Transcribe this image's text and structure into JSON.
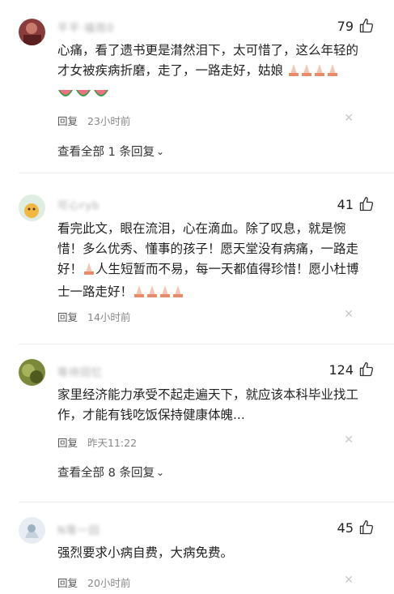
{
  "comments": [
    {
      "username": "平平·福雨0",
      "likes": "79",
      "text": "心痛，看了遗书更是潸然泪下，太可惜了，这么年轻的才女被疾病折磨，走了，一路走好，姑娘",
      "reply_label": "回复",
      "time": "23小时前",
      "more_replies": "查看全部 1 条回复"
    },
    {
      "username": "可心ryb",
      "likes": "41",
      "text_a": "看完此文，眼在流泪，心在滴血。除了叹息，就是惋惜！多么优秀、懂事的孩子！愿天堂没有病痛，一路走好！",
      "text_b": "人生短暂而不易，每一天都值得珍惜！愿小杜博士一路走好！",
      "reply_label": "回复",
      "time": "14小时前"
    },
    {
      "username": "等待回忆",
      "likes": "124",
      "text": "家里经济能力承受不起走遍天下，就应该本科毕业找工作，才能有钱吃饭保持健康体魄...",
      "reply_label": "回复",
      "time": "昨天11:22",
      "more_replies": "查看全部 8 条回复"
    },
    {
      "username": "N等一回",
      "likes": "45",
      "text": "强烈要求小病自费，大病免费。",
      "reply_label": "回复",
      "time": "20小时前"
    }
  ],
  "icons": {
    "like": "thumbs-up-icon",
    "close": "close-icon",
    "expand": "chevron-down-icon",
    "pray": "praying-hands-emoji",
    "watermelon": "watermelon-emoji"
  },
  "colors": {
    "text": "#222222",
    "meta": "#888888",
    "divider": "#ececec"
  }
}
